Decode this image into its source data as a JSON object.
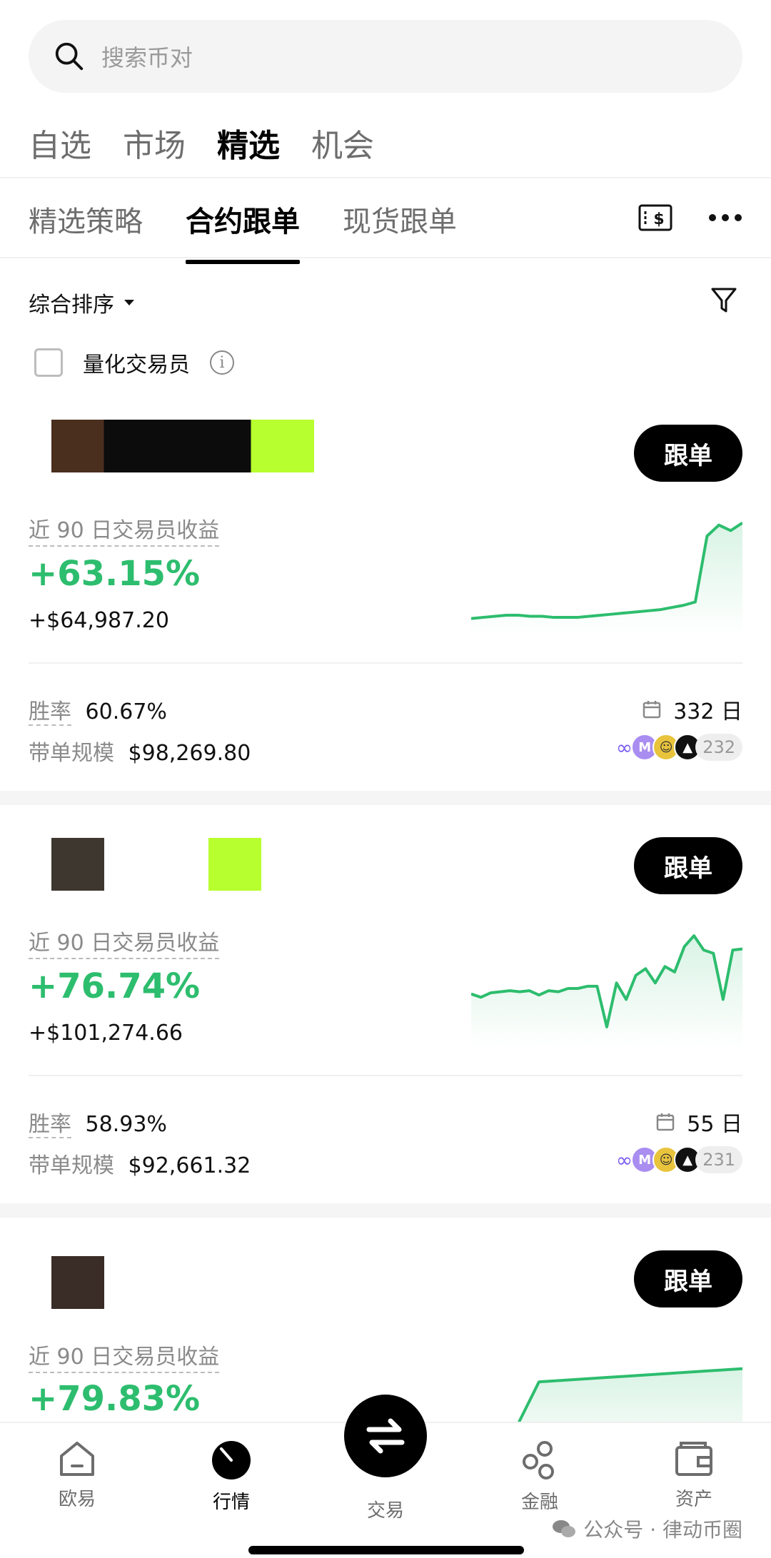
{
  "search": {
    "placeholder": "搜索币对"
  },
  "top_tabs": [
    {
      "label": "自选",
      "active": false
    },
    {
      "label": "市场",
      "active": false
    },
    {
      "label": "精选",
      "active": true
    },
    {
      "label": "机会",
      "active": false
    }
  ],
  "sub_tabs": [
    {
      "label": "精选策略",
      "active": false
    },
    {
      "label": "合约跟单",
      "active": true
    },
    {
      "label": "现货跟单",
      "active": false
    }
  ],
  "sort": {
    "label": "综合排序"
  },
  "quant_filter": {
    "label": "量化交易员",
    "checked": false
  },
  "cards": [
    {
      "follow_label": "跟单",
      "profit_label": "近 90 日交易员收益",
      "profit_pct": "+63.15%",
      "profit_usd": "+$64,987.20",
      "winrate_label": "胜率",
      "winrate": "60.67%",
      "days": "332 日",
      "scale_label": "带单规模",
      "scale": "$98,269.80",
      "followers_count": "232",
      "sparkline": [
        0.1,
        0.11,
        0.12,
        0.13,
        0.13,
        0.12,
        0.12,
        0.11,
        0.11,
        0.11,
        0.12,
        0.13,
        0.14,
        0.15,
        0.16,
        0.17,
        0.18,
        0.2,
        0.22,
        0.25,
        0.85,
        0.95,
        0.9,
        0.97
      ]
    },
    {
      "follow_label": "跟单",
      "profit_label": "近 90 日交易员收益",
      "profit_pct": "+76.74%",
      "profit_usd": "+$101,274.66",
      "winrate_label": "胜率",
      "winrate": "58.93%",
      "days": "55 日",
      "scale_label": "带单规模",
      "scale": "$92,661.32",
      "followers_count": "231",
      "sparkline": [
        0.45,
        0.42,
        0.46,
        0.47,
        0.48,
        0.47,
        0.48,
        0.44,
        0.48,
        0.47,
        0.5,
        0.5,
        0.52,
        0.52,
        0.15,
        0.55,
        0.4,
        0.62,
        0.68,
        0.55,
        0.7,
        0.65,
        0.88,
        0.98,
        0.85,
        0.82,
        0.4,
        0.85,
        0.86
      ]
    },
    {
      "follow_label": "跟单",
      "profit_label": "近 90 日交易员收益",
      "profit_pct": "+79.83%",
      "sparkline": [
        0.05,
        0.08,
        0.7,
        0.72,
        0.74,
        0.76,
        0.78,
        0.8,
        0.82
      ]
    }
  ],
  "bottom_nav": [
    {
      "label": "欧易",
      "icon": "home-icon",
      "active": false
    },
    {
      "label": "行情",
      "icon": "market-icon",
      "active": true
    },
    {
      "label": "交易",
      "icon": "swap-icon",
      "active": false
    },
    {
      "label": "金融",
      "icon": "finance-icon",
      "active": false
    },
    {
      "label": "资产",
      "icon": "wallet-icon",
      "active": false
    }
  ],
  "watermark": "公众号 · 律动币圈",
  "colors": {
    "green": "#2dbd6e",
    "accent_lime": "#b7ff2e",
    "black": "#000000"
  }
}
